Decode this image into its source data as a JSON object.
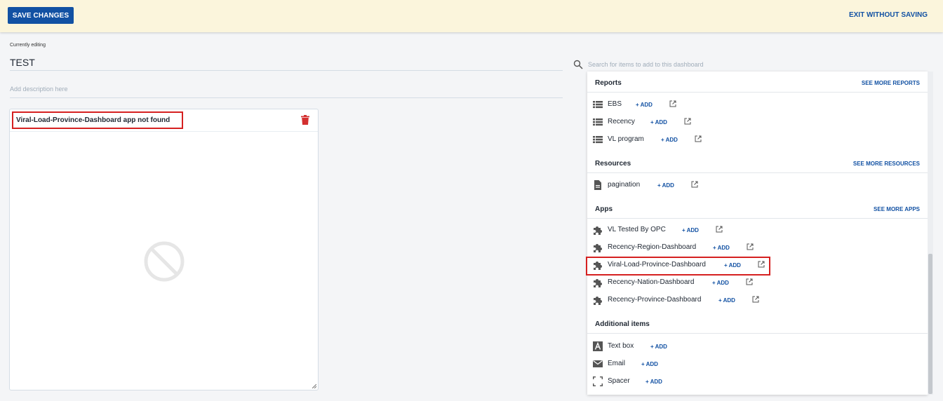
{
  "topbar": {
    "save_label": "SAVE CHANGES",
    "exit_label": "EXIT WITHOUT SAVING"
  },
  "editor": {
    "currently_editing_label": "Currently editing",
    "title_value": "TEST",
    "description_placeholder": "Add description here"
  },
  "item": {
    "title": "Viral-Load-Province-Dashboard app not found"
  },
  "search": {
    "placeholder": "Search for items to add to this dashboard"
  },
  "add_label": "+ ADD",
  "sections": {
    "reports": {
      "title": "Reports",
      "see_more": "SEE MORE REPORTS",
      "items": [
        {
          "label": "EBS",
          "icon": "table-icon"
        },
        {
          "label": "Recency",
          "icon": "table-icon"
        },
        {
          "label": "VL program",
          "icon": "table-icon"
        }
      ]
    },
    "resources": {
      "title": "Resources",
      "see_more": "SEE MORE RESOURCES",
      "items": [
        {
          "label": "pagination",
          "icon": "document-icon"
        }
      ]
    },
    "apps": {
      "title": "Apps",
      "see_more": "SEE MORE APPS",
      "items": [
        {
          "label": "VL Tested By OPC",
          "icon": "puzzle-icon"
        },
        {
          "label": "Recency-Region-Dashboard",
          "icon": "puzzle-icon"
        },
        {
          "label": "Viral-Load-Province-Dashboard",
          "icon": "puzzle-icon"
        },
        {
          "label": "Recency-Nation-Dashboard",
          "icon": "puzzle-icon"
        },
        {
          "label": "Recency-Province-Dashboard",
          "icon": "puzzle-icon"
        }
      ]
    },
    "additional": {
      "title": "Additional items",
      "items": [
        {
          "label": "Text box",
          "icon": "text-box-icon"
        },
        {
          "label": "Email",
          "icon": "email-icon"
        },
        {
          "label": "Spacer",
          "icon": "spacer-icon"
        }
      ]
    }
  },
  "colors": {
    "primary": "#1251a3",
    "topbar_bg": "#fbf5dc",
    "highlight": "#d52020",
    "delete": "#d32f2f"
  }
}
